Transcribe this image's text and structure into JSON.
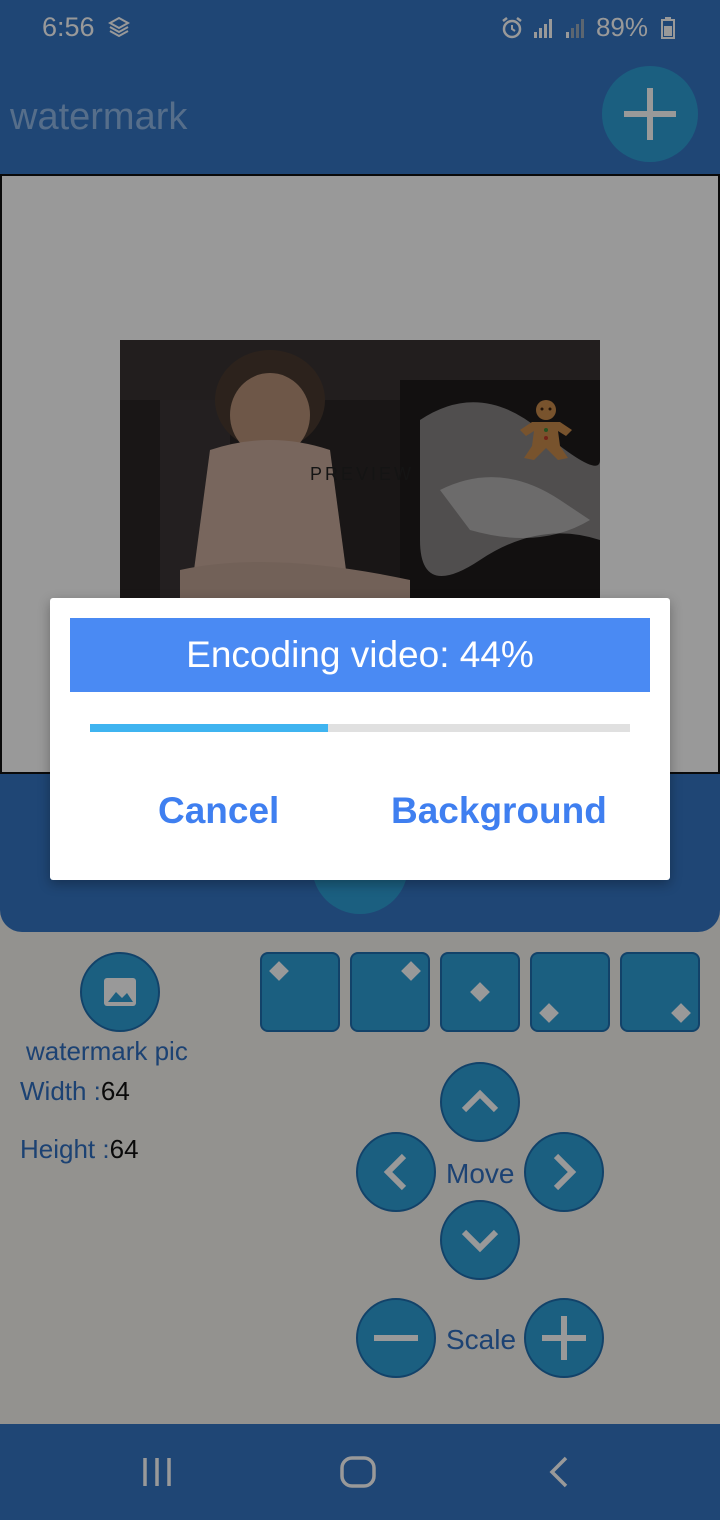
{
  "status_bar": {
    "time": "6:56",
    "battery": "89%"
  },
  "app_bar": {
    "title": "watermark",
    "add_icon": "plus-icon"
  },
  "preview": {
    "label": "PREVIEW",
    "watermark_icon": "gingerbread-man-icon"
  },
  "controls": {
    "pic_label": "watermark pic",
    "width_label": "Width :",
    "width_value": "64",
    "height_label": "Height :",
    "height_value": "64",
    "move_label": "Move",
    "scale_label": "Scale",
    "position_icons": [
      "top-left",
      "top-right",
      "center",
      "bottom-left",
      "bottom-right"
    ]
  },
  "dialog": {
    "title": "Encoding video: 44%",
    "progress": 0.44,
    "cancel_label": "Cancel",
    "background_label": "Background"
  },
  "colors": {
    "primary": "#3476c4",
    "accent": "#2e9fd6",
    "dialog_header": "#4a8af3",
    "progress": "#3fb4f0",
    "button_text": "#3f7ff0"
  }
}
